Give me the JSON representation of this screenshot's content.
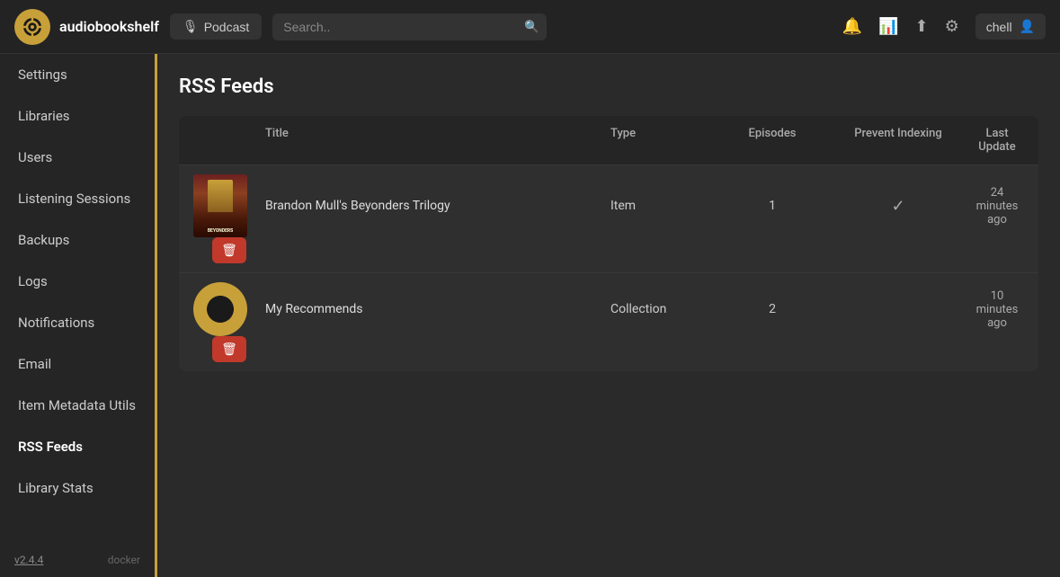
{
  "header": {
    "app_name": "audiobookshelf",
    "podcast_label": "Podcast",
    "search_placeholder": "Search..",
    "user_name": "chell"
  },
  "sidebar": {
    "items": [
      {
        "id": "settings",
        "label": "Settings",
        "active": false
      },
      {
        "id": "libraries",
        "label": "Libraries",
        "active": false
      },
      {
        "id": "users",
        "label": "Users",
        "active": false
      },
      {
        "id": "listening-sessions",
        "label": "Listening Sessions",
        "active": false
      },
      {
        "id": "backups",
        "label": "Backups",
        "active": false
      },
      {
        "id": "logs",
        "label": "Logs",
        "active": false
      },
      {
        "id": "notifications",
        "label": "Notifications",
        "active": false
      },
      {
        "id": "email",
        "label": "Email",
        "active": false
      },
      {
        "id": "item-metadata-utils",
        "label": "Item Metadata Utils",
        "active": false
      },
      {
        "id": "rss-feeds",
        "label": "RSS Feeds",
        "active": true
      },
      {
        "id": "library-stats",
        "label": "Library Stats",
        "active": false
      }
    ],
    "footer": {
      "version": "v2.4.4",
      "env": "docker"
    }
  },
  "main": {
    "page_title": "RSS Feeds",
    "table": {
      "columns": {
        "title": "Title",
        "type": "Type",
        "episodes": "Episodes",
        "prevent_indexing": "Prevent Indexing",
        "last_update": "Last Update"
      },
      "rows": [
        {
          "id": "row1",
          "title": "Brandon Mull's Beyonders Trilogy",
          "type": "Item",
          "episodes": "1",
          "prevent_indexing": true,
          "last_update": "24 minutes ago",
          "thumb_type": "book"
        },
        {
          "id": "row2",
          "title": "My Recommends",
          "type": "Collection",
          "episodes": "2",
          "prevent_indexing": false,
          "last_update": "10 minutes ago",
          "thumb_type": "logo"
        }
      ]
    }
  }
}
